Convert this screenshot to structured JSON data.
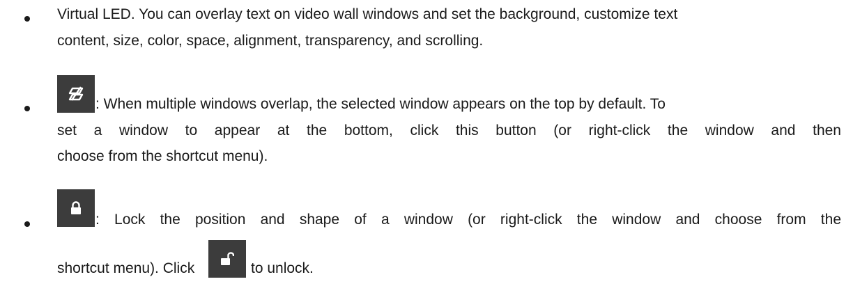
{
  "items": [
    {
      "line1": "Virtual LED. You can overlay text on video wall windows and set the background, customize text",
      "line2": "content, size, color, space, alignment, transparency, and scrolling."
    },
    {
      "icon": "layer-bottom-icon",
      "line1": ": When multiple windows overlap, the selected window appears on the top by default. To",
      "line2": "set a window to appear at the bottom, click this button (or right-click the window and then",
      "line3": "choose from the shortcut menu)."
    },
    {
      "icon": "lock-icon",
      "line1": ": Lock the position and shape of a window (or right-click the window and choose from the",
      "line2_before": "shortcut menu). Click",
      "line2_icon": "unlock-icon",
      "line2_after": "to unlock."
    }
  ],
  "colors": {
    "icon_background": "#3c3c3c",
    "icon_foreground": "#ffffff",
    "text": "#1a1a1a"
  }
}
